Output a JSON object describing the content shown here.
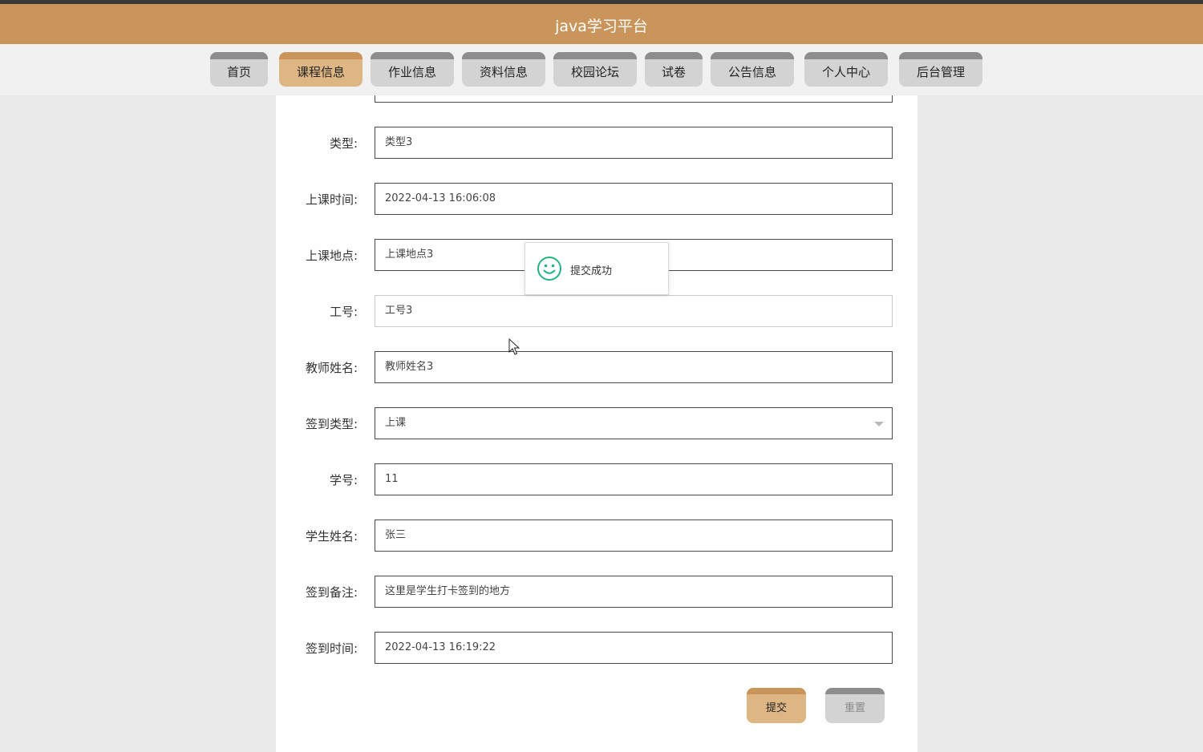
{
  "header": {
    "title": "java学习平台"
  },
  "nav": {
    "items": [
      {
        "label": "首页"
      },
      {
        "label": "课程信息",
        "active": true
      },
      {
        "label": "作业信息"
      },
      {
        "label": "资料信息"
      },
      {
        "label": "校园论坛"
      },
      {
        "label": "试卷"
      },
      {
        "label": "公告信息"
      },
      {
        "label": "个人中心"
      },
      {
        "label": "后台管理"
      }
    ]
  },
  "form": {
    "type": {
      "label": "类型:",
      "value": "类型3"
    },
    "class_time": {
      "label": "上课时间:",
      "value": "2022-04-13 16:06:08"
    },
    "class_location": {
      "label": "上课地点:",
      "value": "上课地点3"
    },
    "staff_id": {
      "label": "工号:",
      "value": "工号3"
    },
    "teacher_name": {
      "label": "教师姓名:",
      "value": "教师姓名3"
    },
    "checkin_type": {
      "label": "签到类型:",
      "value": "上课"
    },
    "student_id": {
      "label": "学号:",
      "value": "11"
    },
    "student_name": {
      "label": "学生姓名:",
      "value": "张三"
    },
    "checkin_note": {
      "label": "签到备注:",
      "value": "这里是学生打卡签到的地方"
    },
    "checkin_time": {
      "label": "签到时间:",
      "value": "2022-04-13 16:19:22"
    },
    "submit_label": "提交",
    "reset_label": "重置"
  },
  "toast": {
    "message": "提交成功",
    "icon": "smile-icon",
    "color": "#24b47e"
  },
  "colors": {
    "brand": "#c9955a",
    "active_tab": "#ddb684",
    "inactive_tab": "#d3d3d3"
  }
}
